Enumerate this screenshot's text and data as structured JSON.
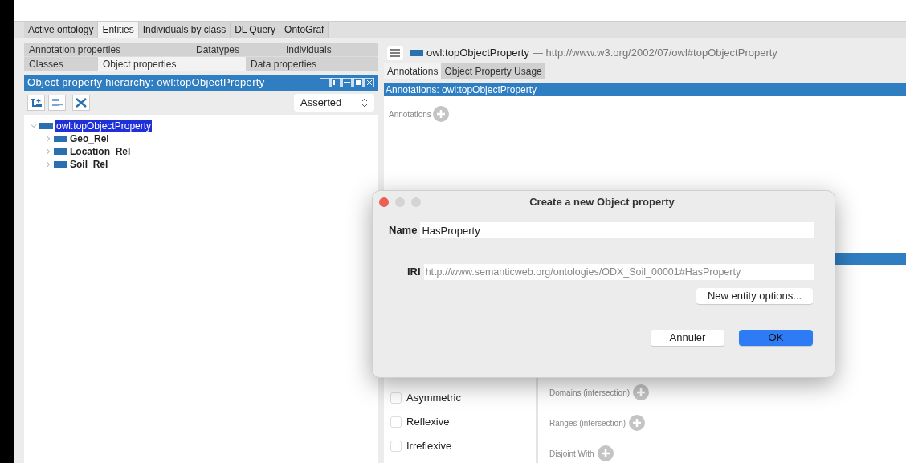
{
  "main_tabs": [
    {
      "label": "Active ontology",
      "selected": false
    },
    {
      "label": "Entities",
      "selected": true
    },
    {
      "label": "Individuals by class",
      "selected": false
    },
    {
      "label": "DL Query",
      "selected": false
    },
    {
      "label": "OntoGraf",
      "selected": false
    }
  ],
  "entity_tabs": [
    [
      {
        "label": "Annotation properties",
        "selected": false
      },
      {
        "label": "Datatypes",
        "selected": false
      },
      {
        "label": "Individuals",
        "selected": false
      }
    ],
    [
      {
        "label": "Classes",
        "selected": false
      },
      {
        "label": "Object properties",
        "selected": true
      },
      {
        "label": "Data properties",
        "selected": false
      }
    ]
  ],
  "hierarchy": {
    "title": "Object property hierarchy: owl:topObjectProperty",
    "view": "Asserted",
    "tree": [
      {
        "label": "owl:topObjectProperty",
        "selected": true,
        "expanded": true,
        "children": [
          {
            "label": "Geo_Rel",
            "selected": false,
            "expanded": false
          },
          {
            "label": "Location_Rel",
            "selected": false,
            "expanded": false
          },
          {
            "label": "Soil_Rel",
            "selected": false,
            "expanded": false
          }
        ]
      }
    ]
  },
  "entity": {
    "name": "owl:topObjectProperty",
    "iri": "— http://www.w3.org/2002/07/owl#topObjectProperty"
  },
  "detail_tabs": [
    {
      "label": "Annotations",
      "selected": true
    },
    {
      "label": "Object Property Usage",
      "selected": false
    }
  ],
  "annotations": {
    "title": "Annotations: owl:topObjectProperty",
    "label": "Annotations"
  },
  "characteristics": [
    {
      "label": "Asymmetric",
      "checked": false
    },
    {
      "label": "Reflexive",
      "checked": false
    },
    {
      "label": "Irreflexive",
      "checked": false
    }
  ],
  "descriptions": [
    {
      "label": "Domains (intersection)"
    },
    {
      "label": "Ranges (intersection)"
    },
    {
      "label": "Disjoint With"
    }
  ],
  "dialog": {
    "title": "Create a new Object property",
    "name_label": "Name",
    "name_value": "HasProperty",
    "iri_label": "IRI",
    "iri_value": "http://www.semanticweb.org/ontologies/ODX_Soil_00001#HasProperty",
    "options_button": "New entity options...",
    "buttons": [
      {
        "label": "Annuler",
        "kind": "secondary"
      },
      {
        "label": "OK",
        "kind": "primary"
      }
    ]
  }
}
